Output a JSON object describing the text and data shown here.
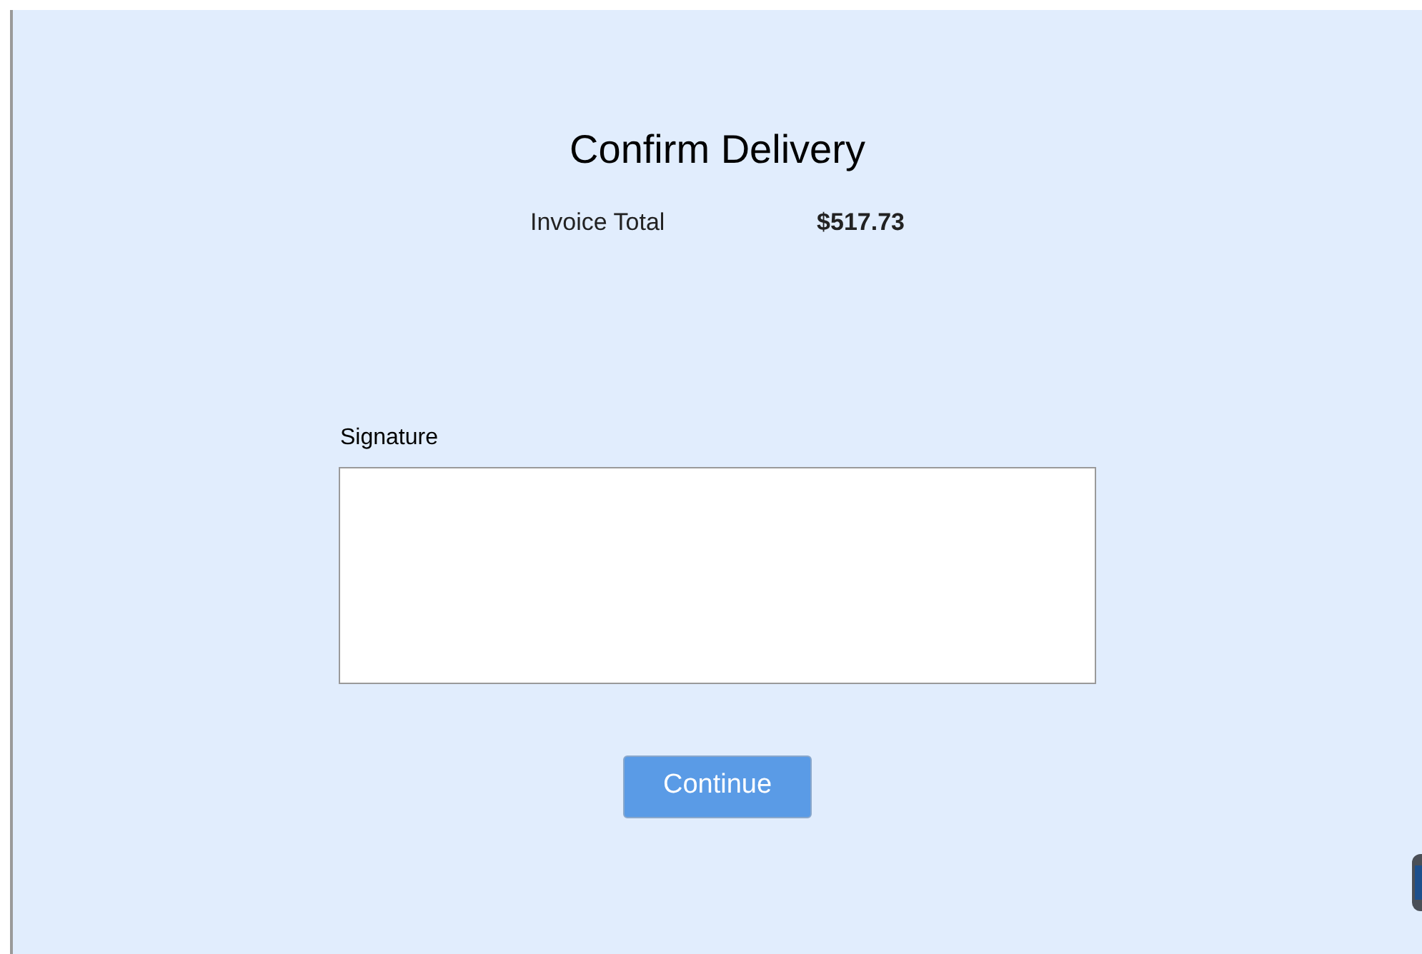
{
  "title": "Confirm Delivery",
  "invoice": {
    "label": "Invoice Total",
    "amount": "$517.73"
  },
  "signature": {
    "label": "Signature"
  },
  "button": {
    "label": "Continue"
  }
}
